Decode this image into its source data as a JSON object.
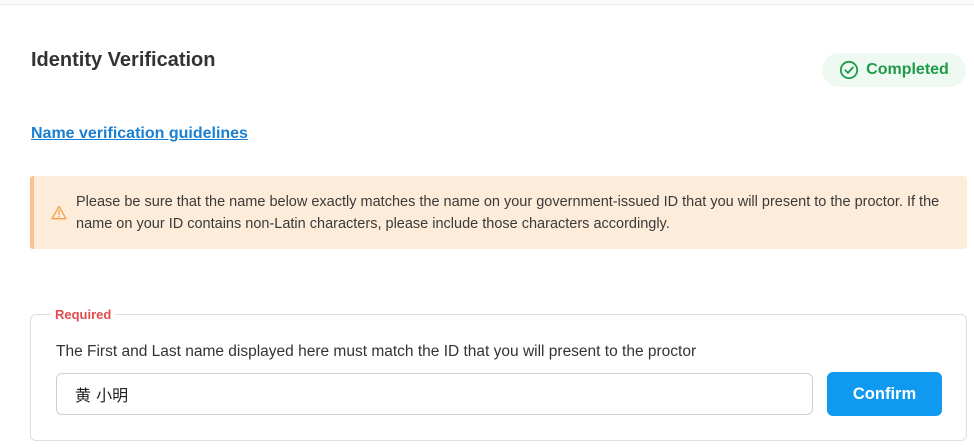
{
  "header": {
    "title": "Identity Verification",
    "status": {
      "label": "Completed",
      "color": "#1f9a4b",
      "icon": "check-circle-icon"
    }
  },
  "guidelines_link": "Name verification guidelines",
  "notice": {
    "icon": "warning-triangle-icon",
    "text": "Please be sure that the name below exactly matches the name on your government-issued ID that you will present to the proctor. If the name on your ID contains non-Latin characters, please include those characters accordingly."
  },
  "name_form": {
    "required_label": "Required",
    "description": "The First and Last name displayed here must match the ID that you will present to the proctor",
    "name_value": "黄 小明",
    "confirm_label": "Confirm"
  },
  "colors": {
    "accent": "#0f9af0",
    "link": "#1b7fd1",
    "warning_bg": "#fdecd9",
    "required": "#e14c4c"
  }
}
